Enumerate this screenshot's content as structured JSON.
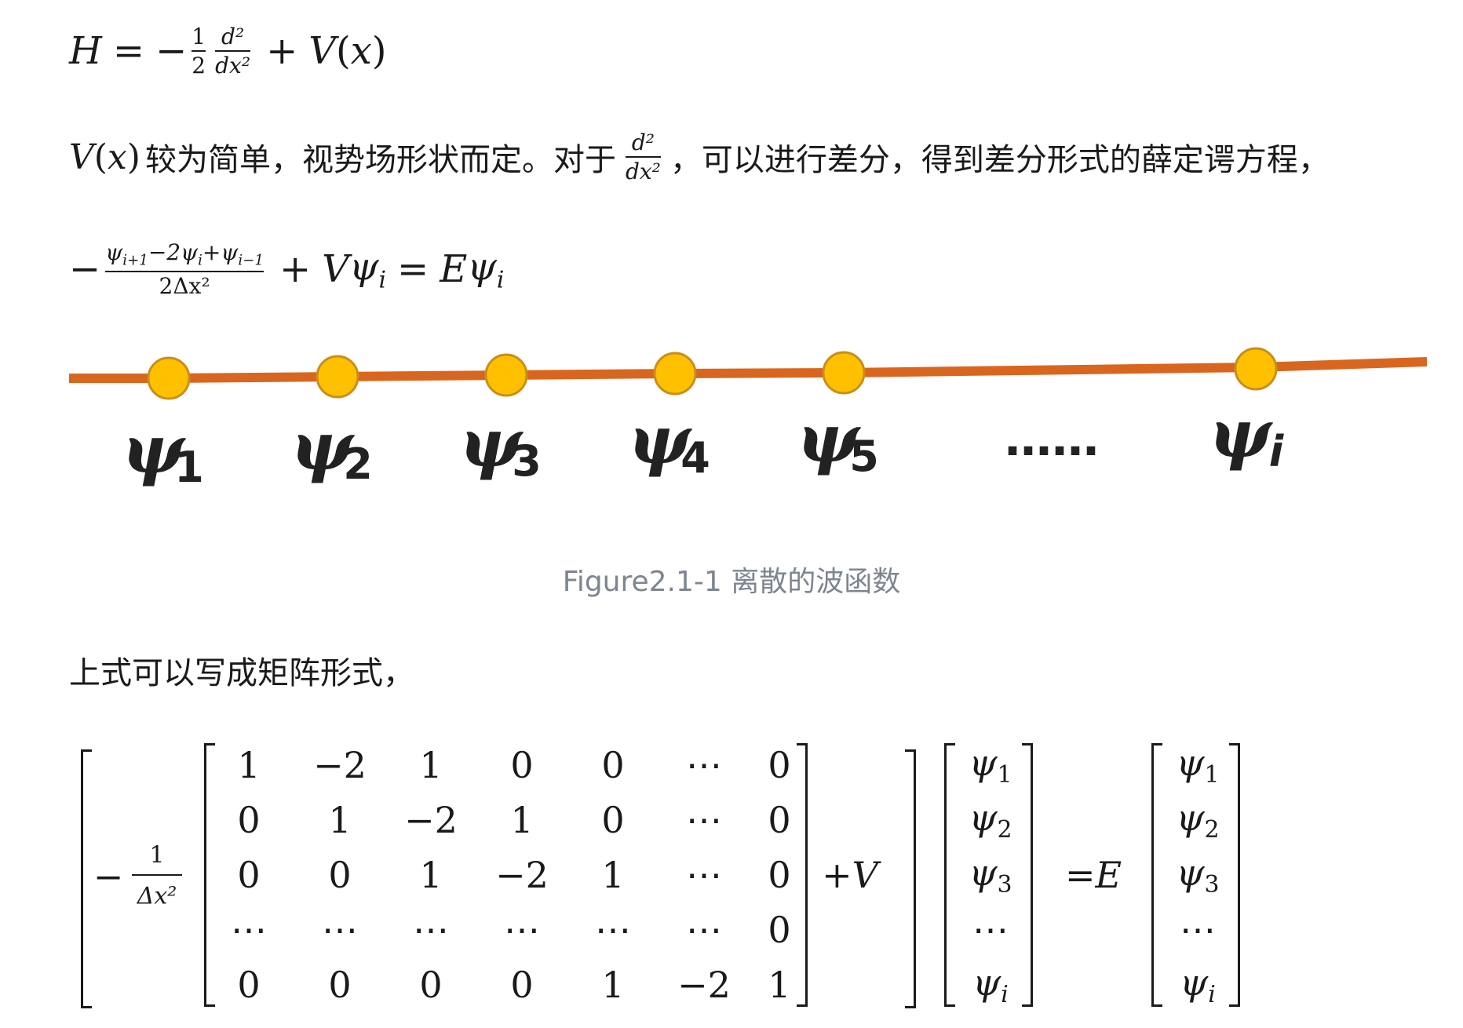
{
  "eq1": {
    "H": "H",
    "eq": "=",
    "minus": "−",
    "half_num": "1",
    "half_den": "2",
    "d2_num": "d²",
    "d2_den": "dx²",
    "plus": "+",
    "V": "V",
    "lparen": "(",
    "x": "x",
    "rparen": ")"
  },
  "textline": {
    "V": "V",
    "lparen": "(",
    "x": "x",
    "rparen": ")",
    "text1": "较为简单，视势场形状而定。对于",
    "d2_num": "d²",
    "d2_den": "dx²",
    "text2": "，可以进行差分，得到差分形式的薛定谔方程，"
  },
  "eq2": {
    "minus": "−",
    "num": "ψ",
    "num_i1": "i+1",
    "num_mid": "−2ψ",
    "num_i": "i",
    "num_plus": "+ψ",
    "num_im1": "i−1",
    "den": "2Δx²",
    "plus": "+",
    "V": "V",
    "psi": "ψ",
    "i": "i",
    "eq": "=",
    "E": "E",
    "psi2": "ψ",
    "i2": "i"
  },
  "figure": {
    "line_color": "#d9661f",
    "node_color": "#ffc000",
    "node_stroke": "#c98e1a",
    "labels": [
      {
        "sym": "ψ",
        "sub": "1"
      },
      {
        "sym": "ψ",
        "sub": "2"
      },
      {
        "sym": "ψ",
        "sub": "3"
      },
      {
        "sym": "ψ",
        "sub": "4"
      },
      {
        "sym": "ψ",
        "sub": "5"
      },
      {
        "sym": "ψ",
        "sub": "i"
      }
    ],
    "ellipsis": "……",
    "caption": "Figure2.1-1 离散的波函数"
  },
  "para": {
    "text": "上式可以写成矩阵形式，"
  },
  "matrix_eq": {
    "minus": "−",
    "frac_num": "1",
    "frac_den": "Δx²",
    "rows": [
      [
        "1",
        "−2",
        "1",
        "0",
        "0",
        "⋯",
        "0"
      ],
      [
        "0",
        "1",
        "−2",
        "1",
        "0",
        "⋯",
        "0"
      ],
      [
        "0",
        "0",
        "1",
        "−2",
        "1",
        "⋯",
        "0"
      ],
      [
        "⋯",
        "⋯",
        "⋯",
        "⋯",
        "⋯",
        "⋯",
        "0"
      ],
      [
        "0",
        "0",
        "0",
        "0",
        "1",
        "−2",
        "1"
      ]
    ],
    "plusV": "+V",
    "eqE": "=E",
    "vec": [
      {
        "sym": "ψ",
        "sub": "1"
      },
      {
        "sym": "ψ",
        "sub": "2"
      },
      {
        "sym": "ψ",
        "sub": "3"
      },
      {
        "sym": "⋯",
        "sub": ""
      },
      {
        "sym": "ψ",
        "sub": "i"
      }
    ]
  }
}
